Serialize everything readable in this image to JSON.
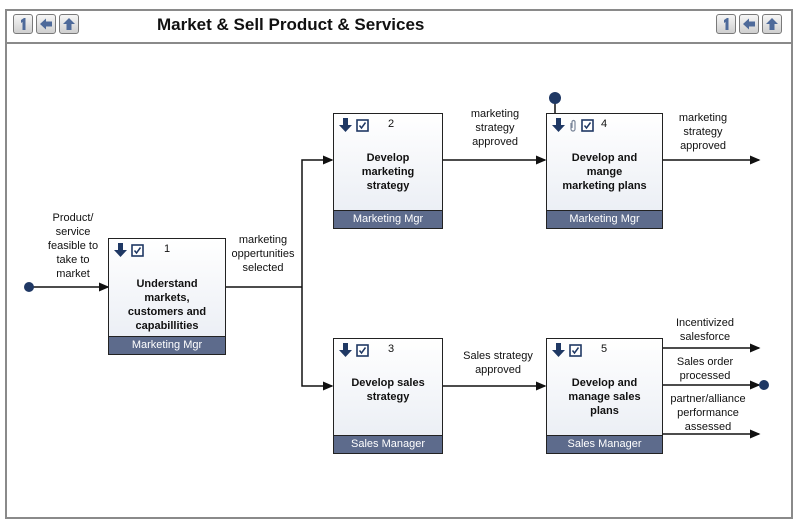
{
  "header": {
    "title": "Market & Sell Product & Services",
    "nav_left": [
      {
        "icon": "level-one-icon",
        "label": "1"
      },
      {
        "icon": "back-arrow-icon",
        "label": ""
      },
      {
        "icon": "up-arrow-icon",
        "label": ""
      }
    ],
    "nav_right": [
      {
        "icon": "level-one-icon",
        "label": "1"
      },
      {
        "icon": "back-arrow-icon",
        "label": ""
      },
      {
        "icon": "up-arrow-icon",
        "label": ""
      }
    ]
  },
  "colors": {
    "footer": "#5d6b8c",
    "icon": "#1f3864",
    "event_dot": "#1f3864",
    "frame": "#8a8a8a"
  },
  "activities": [
    {
      "id": "1",
      "label": "Understand markets, customers and capabillities",
      "lines": [
        "Understand",
        "markets,",
        "customers and",
        "capabillities"
      ],
      "role": "Marketing Mgr",
      "icons": [
        "drill-down-icon",
        "checkbox-icon"
      ]
    },
    {
      "id": "2",
      "label": "Develop marketing strategy",
      "lines": [
        "Develop",
        "marketing",
        "strategy"
      ],
      "role": "Marketing Mgr",
      "icons": [
        "drill-down-icon",
        "checkbox-icon"
      ]
    },
    {
      "id": "3",
      "label": "Develop sales strategy",
      "lines": [
        "Develop sales",
        "strategy"
      ],
      "role": "Sales Manager",
      "icons": [
        "drill-down-icon",
        "checkbox-icon"
      ]
    },
    {
      "id": "4",
      "label": "Develop and mange marketing plans",
      "lines": [
        "Develop and",
        "mange",
        "marketing plans"
      ],
      "role": "Marketing Mgr",
      "icons": [
        "drill-down-icon",
        "attachment-icon",
        "checkbox-icon"
      ]
    },
    {
      "id": "5",
      "label": "Develop and manage sales plans",
      "lines": [
        "Develop and",
        "manage sales",
        "plans"
      ],
      "role": "Sales Manager",
      "icons": [
        "drill-down-icon",
        "checkbox-icon"
      ]
    }
  ],
  "flows": {
    "input": [
      "Product/",
      "service",
      "feasible to",
      "take to",
      "market"
    ],
    "f1_out": [
      "marketing",
      "oppertunities",
      "selected"
    ],
    "f2_out": [
      "marketing",
      "strategy",
      "approved"
    ],
    "f4_out": [
      "marketing",
      "strategy",
      "approved"
    ],
    "f3_out": [
      "Sales strategy",
      "approved"
    ],
    "f5_out_a": [
      "Incentivized",
      "salesforce"
    ],
    "f5_out_b": [
      "Sales order",
      "processed"
    ],
    "f5_out_c": [
      "partner/alliance",
      "performance",
      "assessed"
    ]
  }
}
